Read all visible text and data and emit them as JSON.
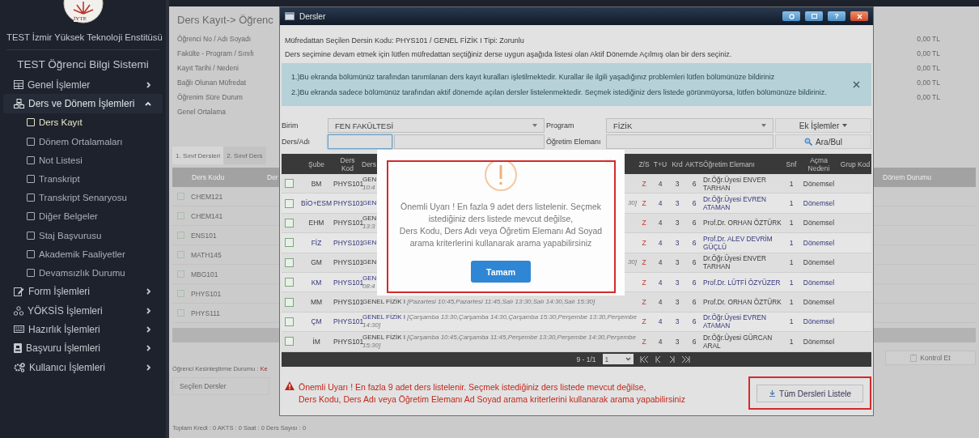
{
  "sidebar": {
    "logo_text": "İYTE",
    "institution": "TEST İzmir Yüksek Teknoloji Enstitüsü",
    "system": "TEST Öğrenci Bilgi Sistemi",
    "menu": [
      {
        "label": "Genel İşlemler",
        "expanded": false
      },
      {
        "label": "Ders ve Dönem İşlemleri",
        "expanded": true,
        "children": [
          {
            "label": "Ders Kayıt",
            "selected": true
          },
          {
            "label": "Dönem Ortalamaları",
            "selected": false
          },
          {
            "label": "Not Listesi",
            "selected": false
          },
          {
            "label": "Transkript",
            "selected": false
          },
          {
            "label": "Transkript Senaryosu",
            "selected": false
          },
          {
            "label": "Diğer Belgeler",
            "selected": false
          },
          {
            "label": "Staj Başvurusu",
            "selected": false
          },
          {
            "label": "Akademik Faaliyetler",
            "selected": false
          },
          {
            "label": "Devamsızlık Durumu",
            "selected": false
          }
        ]
      },
      {
        "label": "Form İşlemleri",
        "expanded": false
      },
      {
        "label": "YÖKSİS İşlemleri",
        "expanded": false
      },
      {
        "label": "Hazırlık İşlemleri",
        "expanded": false
      },
      {
        "label": "Başvuru İşlemleri",
        "expanded": false
      },
      {
        "label": "Kullanıcı İşlemleri",
        "expanded": false
      }
    ]
  },
  "page": {
    "title": "Ders Kayıt->  Öğrenc",
    "fields": [
      {
        "label": "Öğrenci No / Adı Soyadı",
        "amount": "0,00 TL"
      },
      {
        "label": "Fakülte - Program / Sınıfı",
        "amount": "0,00 TL"
      },
      {
        "label": "Kayıt Tarihi / Nedeni",
        "amount": "0,00 TL"
      },
      {
        "label": "Bağlı Olunan Müfredat",
        "amount": "0,00 TL"
      },
      {
        "label": "Öğrenim Süre Durum",
        "amount": "0,00 TL"
      },
      {
        "label": "Genel Ortalama"
      }
    ],
    "tabs": [
      {
        "label": "1. Sınıf Dersleri",
        "selected": true
      },
      {
        "label": "2. Sınıf Ders",
        "selected": false
      }
    ],
    "table": {
      "columns": [
        "Ders Kodu",
        "Der"
      ],
      "right_column": "Dönem Durumu",
      "rows": [
        {
          "code": "CHEM121"
        },
        {
          "code": "CHEM141"
        },
        {
          "code": "ENS101"
        },
        {
          "code": "MATH145"
        },
        {
          "code": "MBG101"
        },
        {
          "code": "PHYS101"
        },
        {
          "code": "PHYS111"
        }
      ]
    },
    "check_button": "Kontrol Et",
    "status_label": "Öğrenci Kesinleştirme Durumu :",
    "status_value": "Ke",
    "selected_title": "Seçilen Dersler",
    "totals": "Toplam Kredi : 0 AKTS : 0 Saat : 0 Ders Sayısı : 0"
  },
  "dialog": {
    "title": "Dersler",
    "help": "?",
    "selected_course": "Müfredattan Seçilen Dersin Kodu: PHYS101 / GENEL FİZİK I Tipi: Zorunlu",
    "instruction": "Ders seçimine devam etmek için lütfen müfredattan seçtiğiniz derse uygun aşağıda listesi olan Aktif Dönemde Açılmış olan bir ders seçiniz.",
    "notices": [
      "1.)Bu ekranda bölümünüz tarafından tanımlanan ders kayıt kuralları işletilmektedir. Kurallar ile ilgili yaşadığınız problemleri lütfen bölümünüze bildiriniz",
      "2.)Bu ekranda sadece bölümünüz tarafından aktif dönemde açılan dersler listelenmektedir. Seçmek istediğiniz ders listede görünmüyorsa, lütfen bölümünüze bildiriniz."
    ],
    "filters": {
      "unit_label": "Birim",
      "unit": "FEN FAKÜLTESİ",
      "program_label": "Program",
      "program": "FİZİK",
      "extra_button": "Ek İşlemler",
      "course_label": "Ders/Adı",
      "instructor_label": "Öğretim Elemanı",
      "search_button": "Ara/Bul"
    },
    "table": {
      "columns": [
        "Şube",
        "Ders Kod",
        "Ders",
        "Z/S",
        "T+U",
        "Krd",
        "AKTS",
        "Öğretim Elemanı",
        "Snf",
        "Açma Nedeni",
        "Grup Kod"
      ],
      "rows": [
        {
          "kind": "partial",
          "section": "BM",
          "code": "PHYS101",
          "course": "GEN",
          "time": "10:4",
          "type": "Z",
          "tu": "4",
          "credit": "3",
          "ects": "6",
          "instructor": "Dr.Öğr.Üyesi ENVER TARHAN",
          "year": "1",
          "reason": "Dönemsel",
          "linked": false
        },
        {
          "kind": "partial",
          "section": "BİO+ESM",
          "code": "PHYS101",
          "course": "GEN",
          "tail": "30]",
          "type": "Z",
          "tu": "4",
          "credit": "3",
          "ects": "6",
          "instructor": "Dr.Öğr.Üyesi EVREN ATAMAN",
          "year": "1",
          "reason": "Dönemsel",
          "linked": true
        },
        {
          "kind": "partial",
          "section": "EHM",
          "code": "PHYS101",
          "course": "GEN",
          "time": "13:3",
          "type": "Z",
          "tu": "4",
          "credit": "3",
          "ects": "6",
          "instructor": "Prof.Dr. ORHAN ÖZTÜRK",
          "year": "1",
          "reason": "Dönemsel",
          "linked": false
        },
        {
          "kind": "partial",
          "section": "FİZ",
          "code": "PHYS101",
          "course": "GEN",
          "type": "Z",
          "tu": "4",
          "credit": "3",
          "ects": "6",
          "instructor": "Prof.Dr. ALEV DEVRİM GÜÇLÜ",
          "year": "1",
          "reason": "Dönemsel",
          "linked": true
        },
        {
          "kind": "partial",
          "section": "GM",
          "code": "PHYS101",
          "course": "GEN",
          "tail": "30]",
          "type": "Z",
          "tu": "4",
          "credit": "3",
          "ects": "6",
          "instructor": "Dr.Öğr.Üyesi ENVER TARHAN",
          "year": "1",
          "reason": "Dönemsel",
          "linked": false
        },
        {
          "kind": "partial",
          "section": "KM",
          "code": "PHYS101",
          "course": "GEN",
          "time": "08:4",
          "type": "Z",
          "tu": "4",
          "credit": "3",
          "ects": "6",
          "instructor": "Prof.Dr. LÜTFİ ÖZYÜZER",
          "year": "1",
          "reason": "Dönemsel",
          "linked": true
        },
        {
          "kind": "full",
          "section": "MM",
          "code": "PHYS101",
          "course": "GENEL FİZİK I",
          "time": "[Pazartesi 10:45,Pazartesi 11:45,Salı 13:30,Salı 14:30,Salı 15:30]",
          "type": "Z",
          "tu": "4",
          "credit": "3",
          "ects": "6",
          "instructor": "Prof.Dr. ORHAN ÖZTÜRK",
          "year": "1",
          "reason": "Dönemsel",
          "linked": false
        },
        {
          "kind": "full",
          "section": "ÇM",
          "code": "PHYS101",
          "course": "GENEL FİZİK I",
          "time": "[Çarşamba 13:30,Çarşamba 14:30,Çarşamba 15:30,Perşembe 13:30,Perşembe 14:30]",
          "type": "Z",
          "tu": "4",
          "credit": "3",
          "ects": "6",
          "instructor": "Dr.Öğr.Üyesi EVREN ATAMAN",
          "year": "1",
          "reason": "Dönemsel",
          "linked": true
        },
        {
          "kind": "full",
          "section": "İM",
          "code": "PHYS101",
          "course": "GENEL FİZİK I",
          "time": "[Çarşamba 10:45,Çarşamba 11:45,Perşembe 13:30,Perşembe 14:30,Perşembe 15:30]",
          "type": "Z",
          "tu": "4",
          "credit": "3",
          "ects": "6",
          "instructor": "Dr.Öğr.Üyesi GÜRCAN ARAL",
          "year": "1",
          "reason": "Dönemsel",
          "linked": false
        }
      ]
    },
    "pager": {
      "summary": "9 - 1/1",
      "page": "1"
    },
    "warning": "Önemli Uyarı ! En fazla 9 adet ders listelenir. Seçmek istediğiniz ders listede mevcut değilse,\nDers Kodu, Ders Adı veya Öğretim Elemanı Ad Soyad arama kriterlerini kullanarak arama yapabilirsiniz",
    "list_all_button": "Tüm Dersleri Listele"
  },
  "alert": {
    "message": "Önemli Uyarı ! En fazla 9 adet ders listelenir. Seçmek istediğiniz ders listede mevcut değilse,\nDers Kodu, Ders Adı veya Öğretim Elemanı Ad Soyad arama kriterlerini kullanarak arama yapabilirsiniz",
    "button": "Tamam"
  }
}
